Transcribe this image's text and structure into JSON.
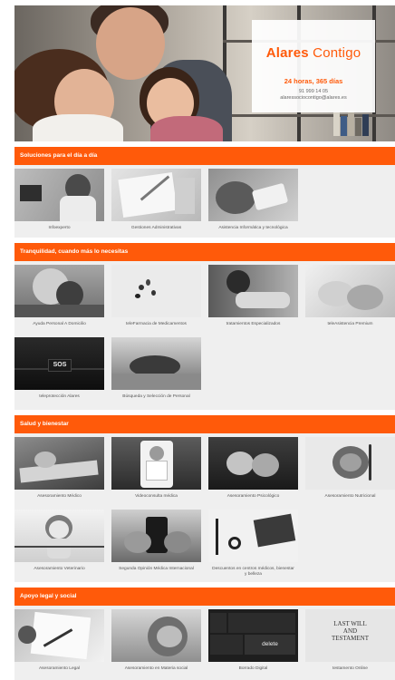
{
  "hero": {
    "brand_strong": "Alares",
    "brand_light": "Contigo",
    "hours": "24 horas, 365 días",
    "phone": "91 999 14 05",
    "email": "alaressociocontigo@alares.es"
  },
  "colors": {
    "accent": "#ff5a0a",
    "section_bg": "#efefef"
  },
  "sections": [
    {
      "title": "Soluciones para el día a día",
      "items": [
        {
          "label": "Infoexperto",
          "icon": "phone-call-photo"
        },
        {
          "label": "Gestiones Administrativas",
          "icon": "paperwork-photo"
        },
        {
          "label": "Asistencia Informática y tecnológica",
          "icon": "smartphone-photo"
        }
      ]
    },
    {
      "title": "Tranquilidad, cuando más lo necesitas",
      "items": [
        {
          "label": "Ayuda Personal A Domicilio",
          "icon": "home-care-photo"
        },
        {
          "label": "teleFarmacia de Medicamentos",
          "icon": "pills-photo"
        },
        {
          "label": "tratamientos Especializados",
          "icon": "physio-photo"
        },
        {
          "label": "teleAsistencia Premium",
          "icon": "hands-photo"
        },
        {
          "label": "teleprotección Alares",
          "icon": "sos-photo"
        },
        {
          "label": "Búsqueda y Selección de Personal",
          "icon": "reaching-hands-photo"
        }
      ]
    },
    {
      "title": "Salud y bienestar",
      "items": [
        {
          "label": "Asesoramiento Médico",
          "icon": "keyboard-photo"
        },
        {
          "label": "Videoconsulta médica",
          "icon": "video-doctor-photo"
        },
        {
          "label": "Asesoramiento Psicológico",
          "icon": "open-hands-photo"
        },
        {
          "label": "Asesoramiento Nutricional",
          "icon": "stethoscope-food-photo"
        },
        {
          "label": "Asesoramiento Veterinario",
          "icon": "dog-photo"
        },
        {
          "label": "Segunda Opinión Médica Internacional",
          "icon": "tablet-photo"
        },
        {
          "label": "Descuentos en centros médicos, bienestar y belleza",
          "icon": "laptop-stethoscope-photo"
        }
      ]
    },
    {
      "title": "Apoyo legal y social",
      "items": [
        {
          "label": "Asesoramiento Legal",
          "icon": "signing-photo"
        },
        {
          "label": "Asesoramiento en Materia social",
          "icon": "elderly-hands-photo"
        },
        {
          "label": "Borrado Digital",
          "icon": "delete-key-photo"
        },
        {
          "label": "testamento Online",
          "icon": "last-will-photo",
          "thumb_text": [
            "LAST WILL",
            "AND",
            "TESTAMENT"
          ]
        },
        {
          "label": "",
          "icon": "",
          "hidden": true
        }
      ]
    }
  ],
  "thumb_texts": {
    "sos": "SOS",
    "delete": "delete"
  }
}
